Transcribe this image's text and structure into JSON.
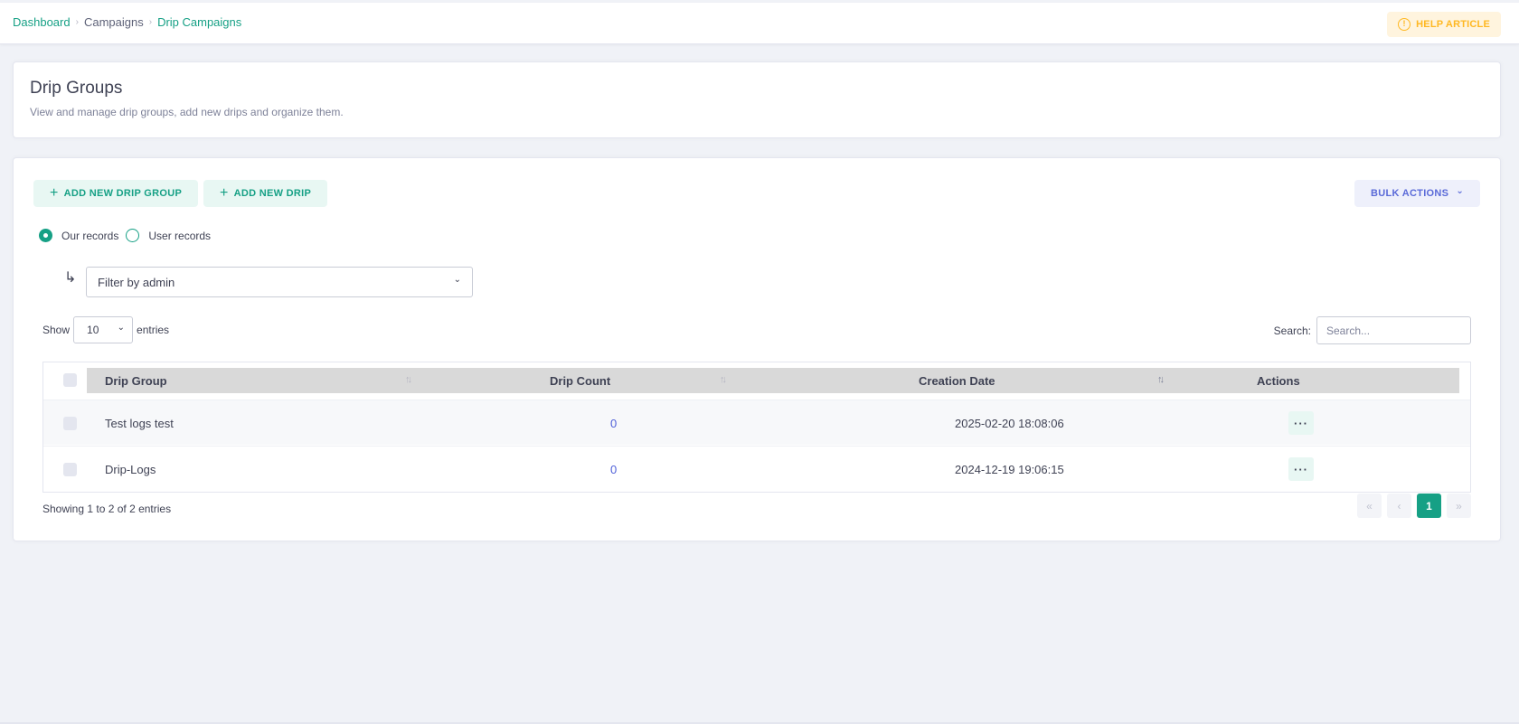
{
  "breadcrumb": {
    "dashboard": "Dashboard",
    "campaigns": "Campaigns",
    "current": "Drip Campaigns",
    "sep": "›"
  },
  "help": {
    "icon": "!",
    "label": "HELP ARTICLE"
  },
  "header": {
    "title": "Drip Groups",
    "subtitle": "View and manage drip groups, add new drips and organize them."
  },
  "toolbar": {
    "add_group": "ADD NEW DRIP GROUP",
    "add_drip": "ADD NEW DRIP",
    "bulk": "BULK ACTIONS",
    "plus": "+",
    "chevron": "⌄"
  },
  "records": {
    "ours": "Our records",
    "users": "User records"
  },
  "filter": {
    "arrow": "↳",
    "value": "Filter by admin",
    "chevron": "⌄"
  },
  "length": {
    "show": "Show",
    "value": "10",
    "entries": "entries",
    "chevron": "⌄"
  },
  "search": {
    "label": "Search:",
    "placeholder": "Search..."
  },
  "table": {
    "headers": {
      "group": "Drip Group",
      "count": "Drip Count",
      "date": "Creation Date",
      "actions": "Actions"
    },
    "sort_icon": "↑↓",
    "rows": [
      {
        "group": "Test logs test",
        "count": "0",
        "date": "2025-02-20 18:08:06",
        "actions": "···"
      },
      {
        "group": "Drip-Logs",
        "count": "0",
        "date": "2024-12-19 19:06:15",
        "actions": "···"
      }
    ]
  },
  "info": "Showing 1 to 2 of 2 entries",
  "pager": {
    "first": "«",
    "prev": "‹",
    "page": "1",
    "next": "»"
  },
  "colors": {
    "accent": "#16a085",
    "help": "#ffb822",
    "bulk": "#5a6ad8",
    "link": "#4e5fd8",
    "bg": "#f0f2f7"
  }
}
